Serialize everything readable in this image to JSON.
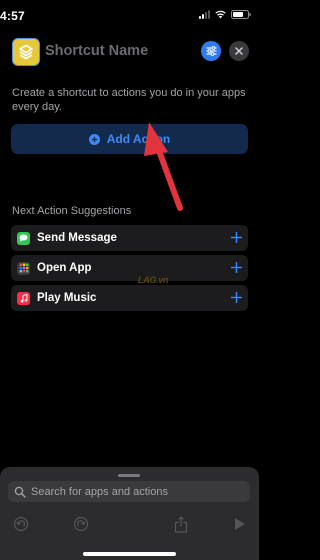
{
  "status_bar": {
    "time": "4:57"
  },
  "header": {
    "shortcut_name": "Shortcut Name",
    "app_icon": "layers-icon",
    "settings_icon": "sliders-icon",
    "close_icon": "close-icon"
  },
  "description": "Create a shortcut to actions you do in your apps every day.",
  "add_action": {
    "label": "Add Action",
    "icon": "plus-circle-icon"
  },
  "suggestions": {
    "header": "Next Action Suggestions",
    "items": [
      {
        "label": "Send Message",
        "icon": "messages-icon",
        "color": "#33c759"
      },
      {
        "label": "Open App",
        "icon": "app-grid-icon",
        "color": "#3a3a3c"
      },
      {
        "label": "Play Music",
        "icon": "music-icon",
        "color": "#fa2d48"
      }
    ]
  },
  "watermark": "LAG.vn",
  "search": {
    "placeholder": "Search for apps and actions"
  },
  "toolbar": {
    "items": [
      "undo-icon",
      "redo-icon",
      "share-icon",
      "play-icon"
    ]
  },
  "colors": {
    "accent": "#3d8bf6",
    "button_bg": "#142a4c",
    "arrow": "#e2343c"
  }
}
